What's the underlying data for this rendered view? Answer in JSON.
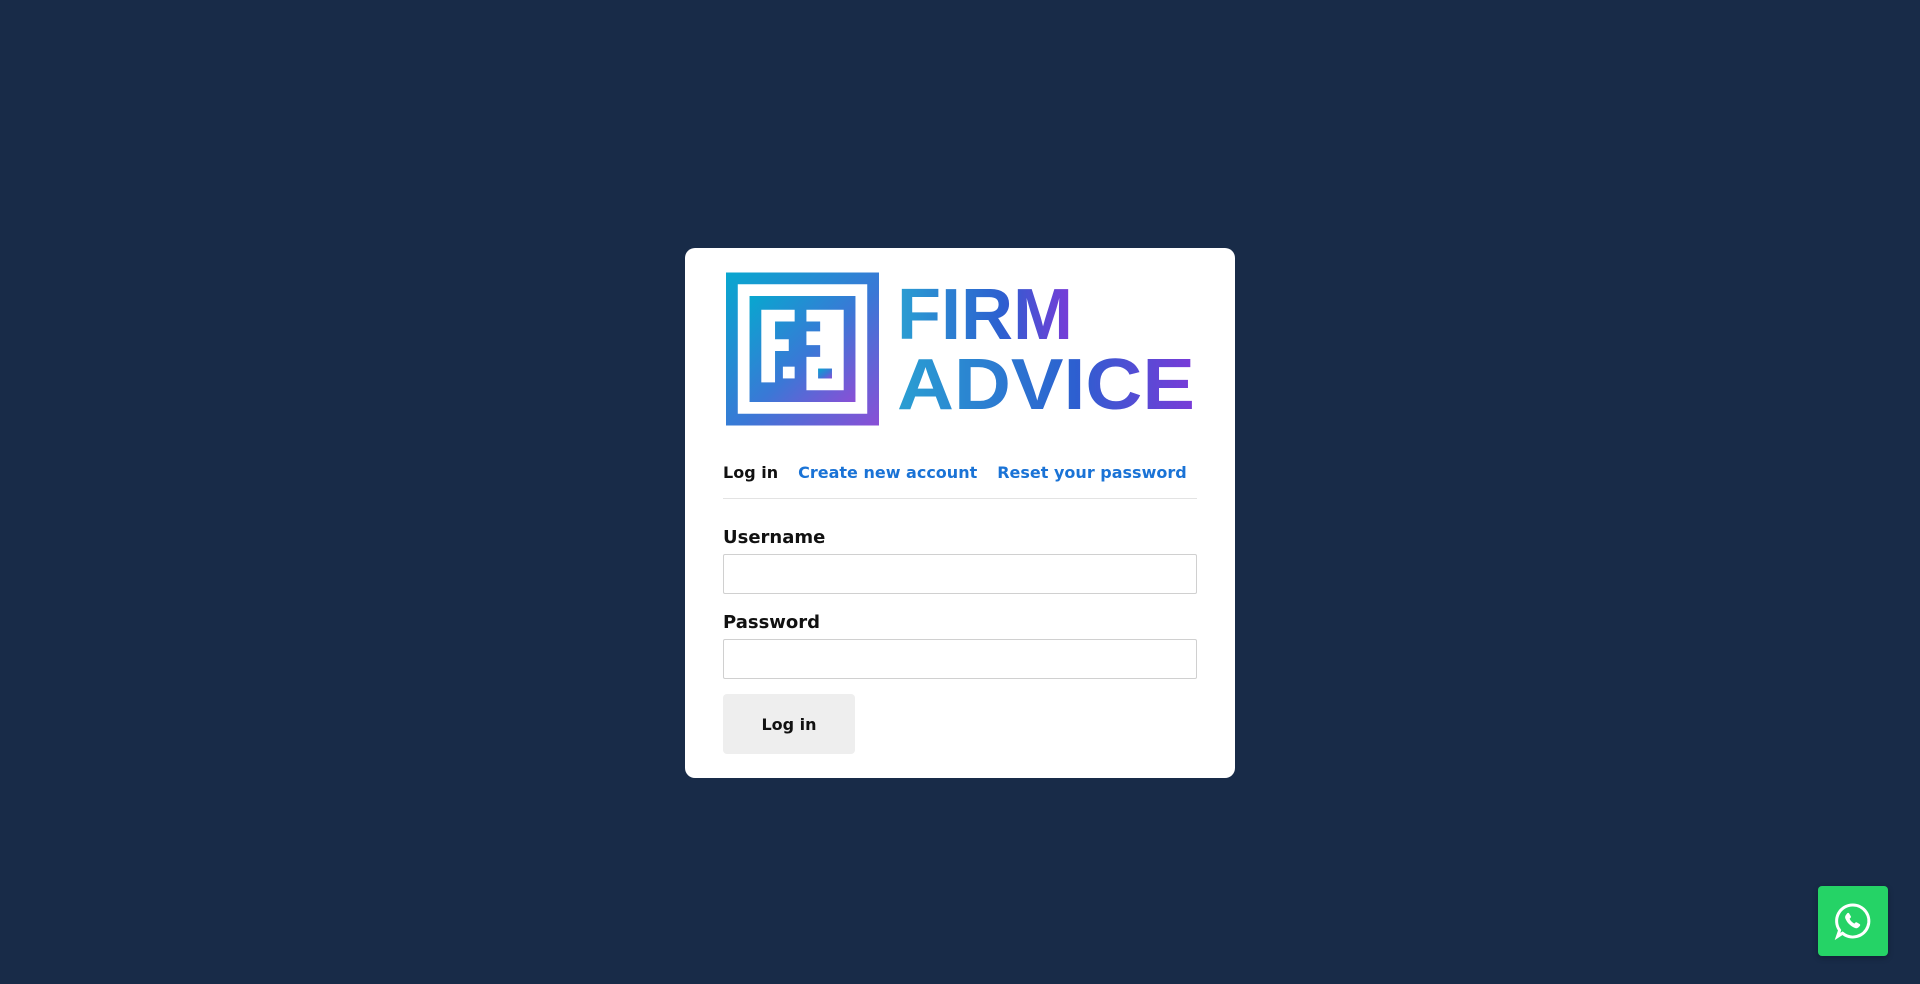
{
  "brand": {
    "logo_line1": "FIRM",
    "logo_line2": "ADVICE",
    "gradient_start": "#0aa6cf",
    "gradient_end": "#7a3ad8"
  },
  "tabs": [
    {
      "label": "Log in",
      "active": true
    },
    {
      "label": "Create new account",
      "active": false
    },
    {
      "label": "Reset your password",
      "active": false
    }
  ],
  "form": {
    "username_label": "Username",
    "username_value": "",
    "password_label": "Password",
    "password_value": "",
    "submit_label": "Log in"
  },
  "floating": {
    "icon": "whatsapp-icon",
    "color": "#25d366"
  },
  "colors": {
    "background": "#182b48",
    "link": "#1a73d6",
    "card": "#ffffff"
  }
}
